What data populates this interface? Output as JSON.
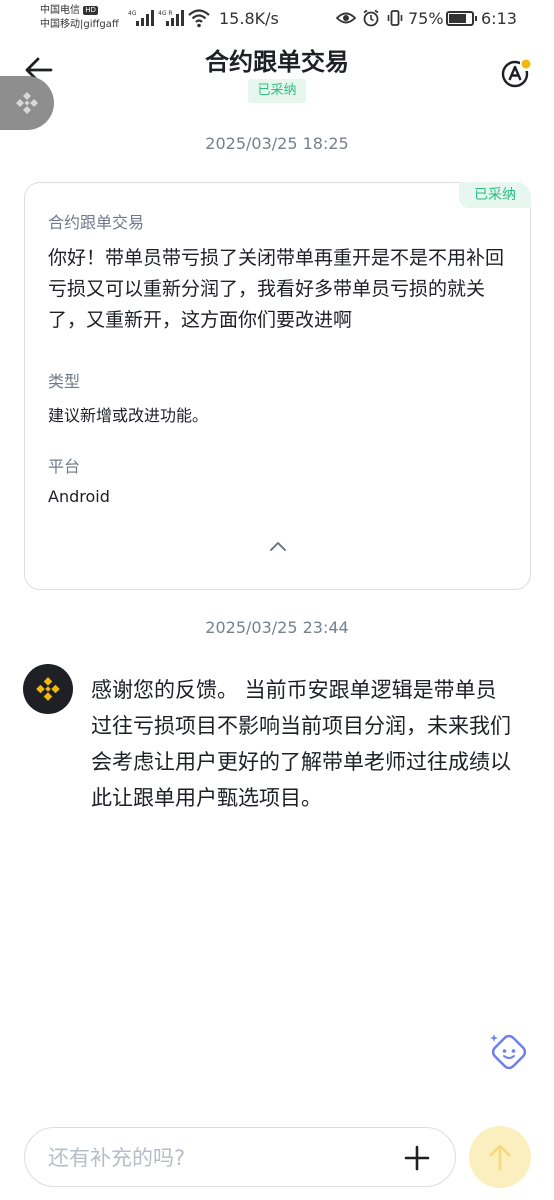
{
  "status_bar": {
    "carrier1": "中国电信",
    "carrier1_badge": "HD",
    "carrier2": "中国移动|giffgaff",
    "network1": "4G",
    "network2": "4G R",
    "speed": "15.8K/s",
    "battery": "75%",
    "battery_level": 0.75,
    "time": "6:13"
  },
  "header": {
    "title": "合约跟单交易",
    "status_badge": "已采纳"
  },
  "conversation": {
    "question_time": "2025/03/25 18:25",
    "card": {
      "badge": "已采纳",
      "category": "合约跟单交易",
      "question": "你好！带单员带亏损了关闭带单再重开是不是不用补回亏损又可以重新分润了，我看好多带单员亏损的就关了，又重新开，这方面你们要改进啊",
      "type_label": "类型",
      "type_value": "建议新增或改进功能。",
      "platform_label": "平台",
      "platform_value": "Android"
    },
    "reply_time": "2025/03/25 23:44",
    "reply": "感谢您的反馈。 当前币安跟单逻辑是带单员过往亏损项目不影响当前项目分润，未来我们会考虑让用户更好的了解带单老师过往成绩以此让跟单用户甄选项目。"
  },
  "input": {
    "placeholder": "还有补充的吗?"
  },
  "colors": {
    "accent_green": "#2ebd85",
    "badge_bg": "#e7f7ef",
    "binance_yellow": "#f0b90b",
    "send_disabled": "#fcefbf"
  }
}
